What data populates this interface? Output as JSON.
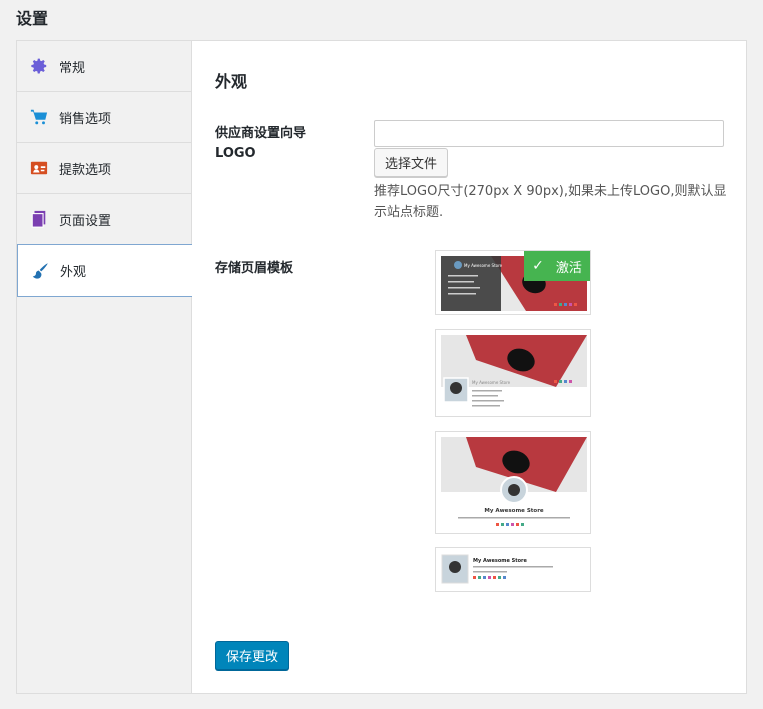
{
  "page": {
    "title": "设置"
  },
  "sidebar": {
    "items": [
      {
        "label": "常规",
        "icon": "gear-icon",
        "color": "#6b5fd8"
      },
      {
        "label": "销售选项",
        "icon": "cart-icon",
        "color": "#1a8fd6"
      },
      {
        "label": "提款选项",
        "icon": "withdraw-icon",
        "color": "#d54e21"
      },
      {
        "label": "页面设置",
        "icon": "pages-icon",
        "color": "#7b3fb1"
      },
      {
        "label": "外观",
        "icon": "paint-brush-icon",
        "color": "#2271b1"
      }
    ],
    "active_index": 4
  },
  "main": {
    "section_title": "外观",
    "logo": {
      "label": "供应商设置向导LOGO",
      "input_value": "",
      "file_button_label": "选择文件",
      "hint": "推荐LOGO尺寸(270px X 90px),如果未上传LOGO,则默认显示站点标题."
    },
    "store_header": {
      "label": "存储页眉模板",
      "active_badge": "激活",
      "template_store_name": "My Awesome Store"
    },
    "save_button_label": "保存更改"
  },
  "colors": {
    "accent": "#0085ba",
    "active_badge": "#46b450"
  }
}
